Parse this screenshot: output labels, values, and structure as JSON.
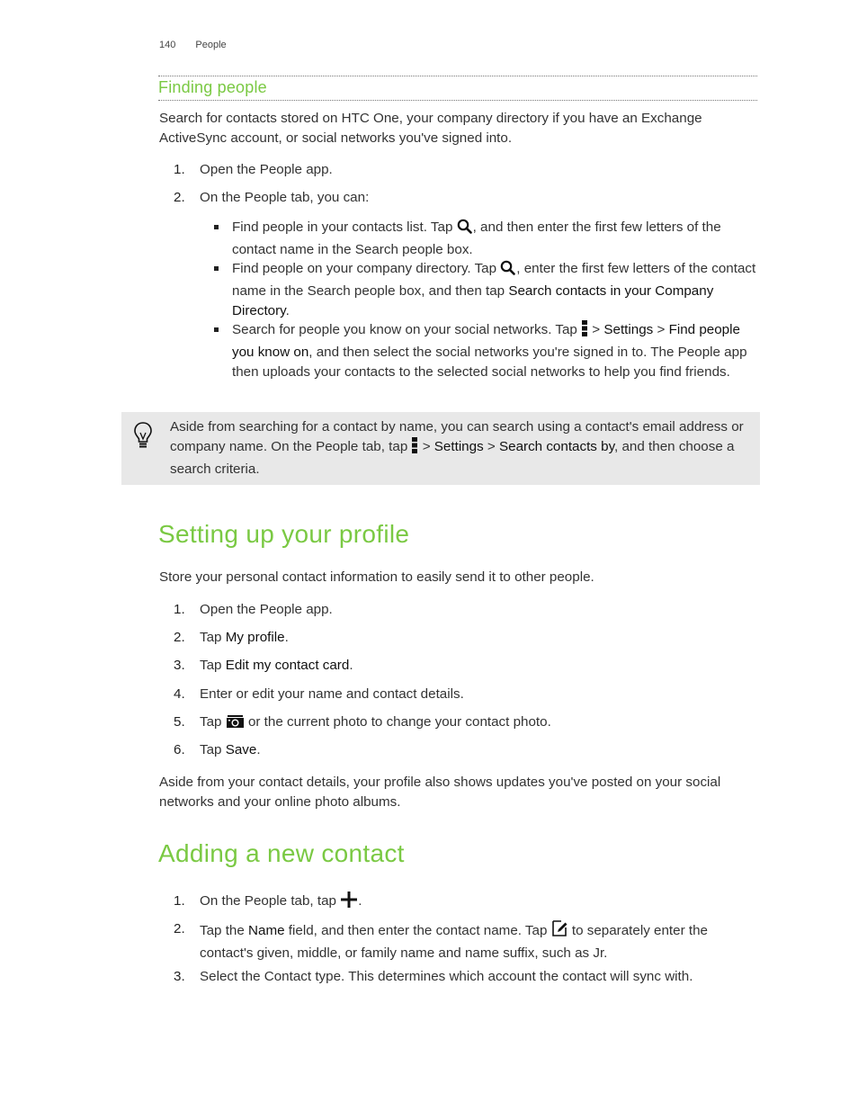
{
  "header": {
    "page_number": "140",
    "chapter": "People"
  },
  "finding_people": {
    "heading": "Finding people",
    "intro": "Search for contacts stored on HTC One, your company directory if you have an Exchange ActiveSync account, or social networks you've signed into.",
    "steps": [
      {
        "n": "1.",
        "text": "Open the People app."
      },
      {
        "n": "2.",
        "text": "On the People tab, you can:"
      }
    ],
    "bullets": [
      {
        "pre": "Find people in your contacts list. Tap ",
        "icon": "search-icon",
        "post": ", and then enter the first few letters of the contact name in the Search people box."
      },
      {
        "pre": "Find people on your company directory. Tap ",
        "icon": "search-icon",
        "mid": ", enter the first few letters of the contact name in the Search people box, and then tap ",
        "em": "Search contacts in your Company Directory",
        "post": "."
      },
      {
        "pre": "Search for people you know on your social networks. Tap ",
        "icon": "overflow-menu-icon",
        "sep1": " > ",
        "em1": "Settings",
        "sep2": " > ",
        "em2": "Find people you know on",
        "post": ", and then select the social networks you're signed in to. The People app then uploads your contacts to the selected social networks to help you find friends."
      }
    ],
    "tip": {
      "icon": "lightbulb-icon",
      "pre": "Aside from searching for a contact by name, you can search using a contact's email address or company name. On the People tab, tap ",
      "menu_icon": "overflow-menu-icon",
      "sep1": " > ",
      "em1": "Settings",
      "sep2": " > ",
      "em2": "Search contacts by",
      "post": ", and then choose a search criteria."
    }
  },
  "profile": {
    "heading": "Setting up your profile",
    "intro": "Store your personal contact information to easily send it to other people.",
    "steps": [
      {
        "n": "1.",
        "pre": "Open the People app.",
        "em": "",
        "post": ""
      },
      {
        "n": "2.",
        "pre": "Tap ",
        "em": "My profile",
        "post": "."
      },
      {
        "n": "3.",
        "pre": "Tap ",
        "em": "Edit my contact card",
        "post": "."
      },
      {
        "n": "4.",
        "pre": "Enter or edit your name and contact details.",
        "em": "",
        "post": ""
      },
      {
        "n": "5.",
        "pre": "Tap ",
        "icon": "camera-icon",
        "post": " or the current photo to change your contact photo."
      },
      {
        "n": "6.",
        "pre": "Tap ",
        "em": "Save",
        "post": "."
      }
    ],
    "outro": "Aside from your contact details, your profile also shows updates you've posted on your social networks and your online photo albums."
  },
  "new_contact": {
    "heading": "Adding a new contact",
    "steps": [
      {
        "n": "1.",
        "pre": "On the People tab, tap ",
        "icon": "plus-icon",
        "post": "."
      },
      {
        "n": "2.",
        "pre": "Tap the ",
        "em": "Name",
        "mid": " field, and then enter the contact name. Tap ",
        "icon": "edit-icon",
        "post": " to separately enter the contact's given, middle, or family name and name suffix, such as Jr."
      },
      {
        "n": "3.",
        "pre": "Select the Contact type. This determines which account the contact will sync with."
      }
    ]
  },
  "colors": {
    "accent": "#7ac943",
    "tip_background": "#e8e8e8",
    "text": "#333333"
  }
}
